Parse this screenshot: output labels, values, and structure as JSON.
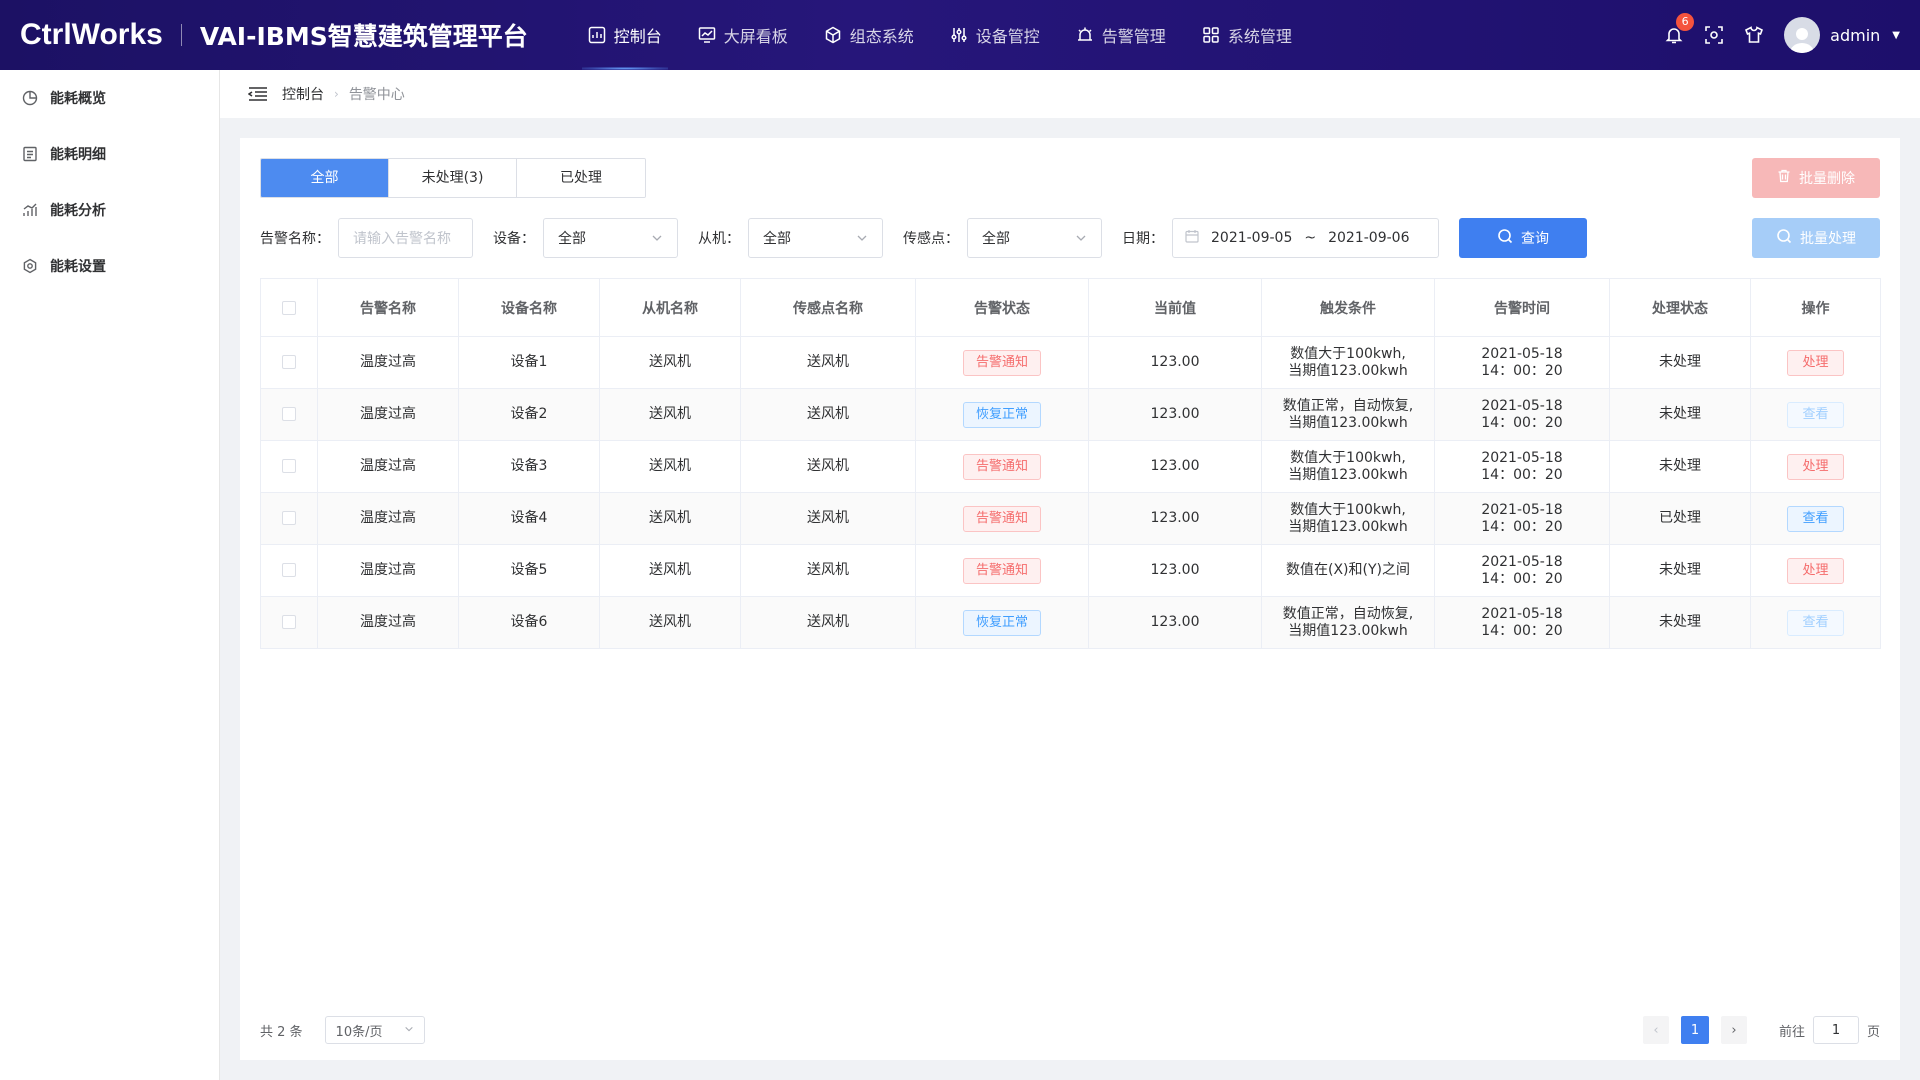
{
  "header": {
    "brand": "CtrlWorks",
    "platform": "VAI-IBMS智慧建筑管理平台",
    "nav": [
      {
        "label": "控制台",
        "icon": "dashboard-icon",
        "active": true
      },
      {
        "label": "大屏看板",
        "icon": "monitor-chart-icon",
        "active": false
      },
      {
        "label": "组态系统",
        "icon": "cube-icon",
        "active": false
      },
      {
        "label": "设备管控",
        "icon": "sliders-icon",
        "active": false
      },
      {
        "label": "告警管理",
        "icon": "alarm-icon",
        "active": false
      },
      {
        "label": "系统管理",
        "icon": "grid-icon",
        "active": false
      }
    ],
    "notification_count": "6",
    "username": "admin"
  },
  "sidebar": {
    "items": [
      {
        "label": "能耗概览",
        "icon": "pie-chart-icon"
      },
      {
        "label": "能耗明细",
        "icon": "document-list-icon"
      },
      {
        "label": "能耗分析",
        "icon": "bar-trend-icon"
      },
      {
        "label": "能耗设置",
        "icon": "gear-icon"
      }
    ]
  },
  "breadcrumb": {
    "root": "控制台",
    "current": "告警中心"
  },
  "tabs": [
    "全部",
    "未处理(3)",
    "已处理"
  ],
  "actions": {
    "batch_delete": "批量删除",
    "batch_process": "批量处理",
    "query": "查询"
  },
  "filters": {
    "alarm_name_label": "告警名称：",
    "alarm_name_placeholder": "请输入告警名称",
    "device_label": "设备：",
    "device_value": "全部",
    "slave_label": "从机：",
    "slave_value": "全部",
    "sensor_label": "传感点：",
    "sensor_value": "全部",
    "date_label": "日期：",
    "date_start": "2021-09-05",
    "date_sep": "~",
    "date_end": "2021-09-06"
  },
  "table": {
    "columns": [
      "告警名称",
      "设备名称",
      "从机名称",
      "传感点名称",
      "告警状态",
      "当前值",
      "触发条件",
      "告警时间",
      "处理状态",
      "操作"
    ],
    "rows": [
      {
        "name": "温度过高",
        "device": "设备1",
        "slave": "送风机",
        "sensor": "送风机",
        "status": "告警通知",
        "status_type": "alarm",
        "value": "123.00",
        "cond1": "数值大于100kwh,",
        "cond2": "当期值123.00kwh",
        "date": "2021-05-18",
        "time": "14：00：20",
        "proc": "未处理",
        "proc_muted": false,
        "op": "处理",
        "op_type": "handle"
      },
      {
        "name": "温度过高",
        "device": "设备2",
        "slave": "送风机",
        "sensor": "送风机",
        "status": "恢复正常",
        "status_type": "recover",
        "value": "123.00",
        "cond1": "数值正常，自动恢复,",
        "cond2": "当期值123.00kwh",
        "date": "2021-05-18",
        "time": "14：00：20",
        "proc": "未处理",
        "proc_muted": true,
        "op": "查看",
        "op_type": "view dim"
      },
      {
        "name": "温度过高",
        "device": "设备3",
        "slave": "送风机",
        "sensor": "送风机",
        "status": "告警通知",
        "status_type": "alarm",
        "value": "123.00",
        "cond1": "数值大于100kwh,",
        "cond2": "当期值123.00kwh",
        "date": "2021-05-18",
        "time": "14：00：20",
        "proc": "未处理",
        "proc_muted": false,
        "op": "处理",
        "op_type": "handle"
      },
      {
        "name": "温度过高",
        "device": "设备4",
        "slave": "送风机",
        "sensor": "送风机",
        "status": "告警通知",
        "status_type": "alarm",
        "value": "123.00",
        "cond1": "数值大于100kwh,",
        "cond2": "当期值123.00kwh",
        "date": "2021-05-18",
        "time": "14：00：20",
        "proc": "已处理",
        "proc_muted": true,
        "op": "查看",
        "op_type": "view"
      },
      {
        "name": "温度过高",
        "device": "设备5",
        "slave": "送风机",
        "sensor": "送风机",
        "status": "告警通知",
        "status_type": "alarm",
        "value": "123.00",
        "cond1": "数值在(X)和(Y)之间",
        "cond2": "",
        "date": "2021-05-18",
        "time": "14：00：20",
        "proc": "未处理",
        "proc_muted": false,
        "op": "处理",
        "op_type": "handle"
      },
      {
        "name": "温度过高",
        "device": "设备6",
        "slave": "送风机",
        "sensor": "送风机",
        "status": "恢复正常",
        "status_type": "recover",
        "value": "123.00",
        "cond1": "数值正常，自动恢复,",
        "cond2": "当期值123.00kwh",
        "date": "2021-05-18",
        "time": "14：00：20",
        "proc": "未处理",
        "proc_muted": true,
        "op": "查看",
        "op_type": "view dim"
      }
    ]
  },
  "pagination": {
    "total_text": "共 2 条",
    "page_size": "10条/页",
    "current_page": "1",
    "goto_label": "前往",
    "goto_value": "1",
    "page_unit": "页"
  },
  "colors": {
    "primary": "#3f7ff0",
    "header_bg": "#1c1164",
    "danger": "#f56c6c"
  }
}
